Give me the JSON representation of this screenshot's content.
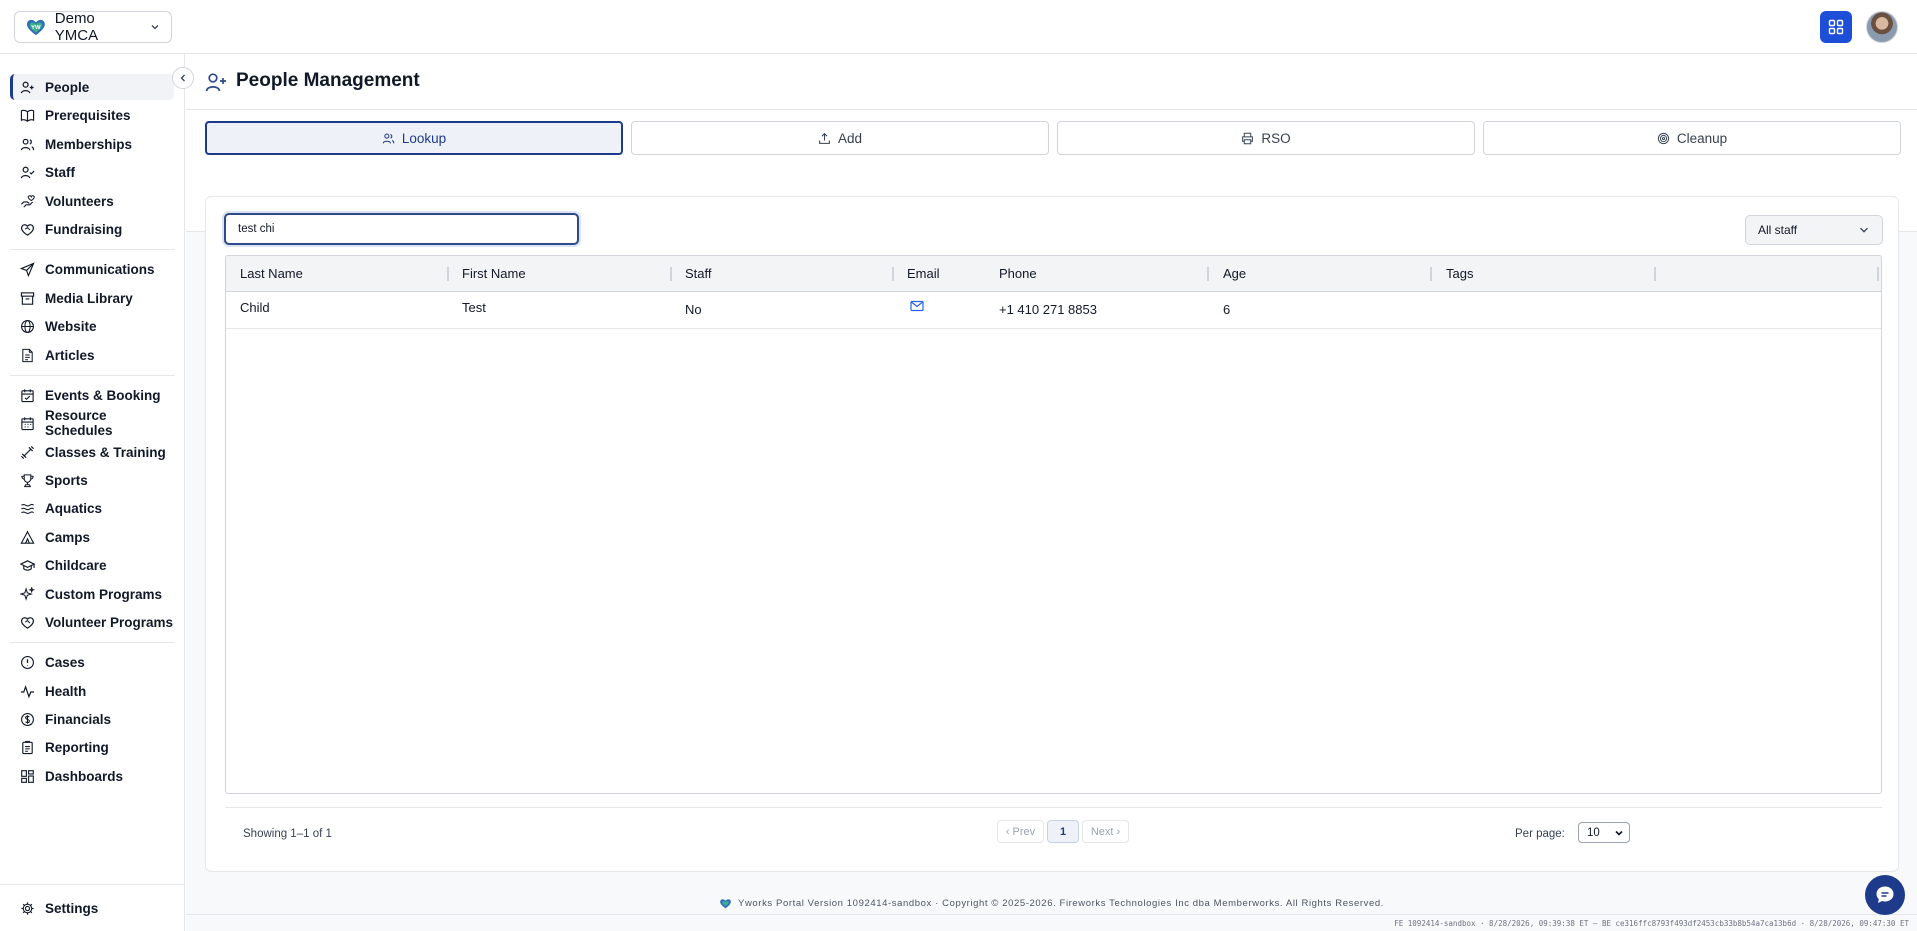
{
  "org": {
    "name": "Demo YMCA",
    "logo_text": "YW"
  },
  "sidebar": {
    "items": [
      {
        "label": "People",
        "icon": "user-plus-icon",
        "active": true
      },
      {
        "label": "Prerequisites",
        "icon": "book-icon"
      },
      {
        "label": "Memberships",
        "icon": "users-icon"
      },
      {
        "label": "Staff",
        "icon": "user-check-icon"
      },
      {
        "label": "Volunteers",
        "icon": "hand-heart-icon"
      },
      {
        "label": "Fundraising",
        "icon": "heart-handshake-icon"
      },
      {
        "label": "Communications",
        "icon": "send-icon"
      },
      {
        "label": "Media Library",
        "icon": "archive-icon"
      },
      {
        "label": "Website",
        "icon": "globe-icon"
      },
      {
        "label": "Articles",
        "icon": "file-text-icon"
      },
      {
        "label": "Events & Booking",
        "icon": "calendar-check-icon"
      },
      {
        "label": "Resource Schedules",
        "icon": "calendar-icon"
      },
      {
        "label": "Classes & Training",
        "icon": "dumbbell-icon"
      },
      {
        "label": "Sports",
        "icon": "trophy-icon"
      },
      {
        "label": "Aquatics",
        "icon": "waves-icon"
      },
      {
        "label": "Camps",
        "icon": "tent-icon"
      },
      {
        "label": "Childcare",
        "icon": "graduation-cap-icon"
      },
      {
        "label": "Custom Programs",
        "icon": "sparkles-icon"
      },
      {
        "label": "Volunteer Programs",
        "icon": "heart-handshake-icon"
      },
      {
        "label": "Cases",
        "icon": "alert-circle-icon"
      },
      {
        "label": "Health",
        "icon": "activity-icon"
      },
      {
        "label": "Financials",
        "icon": "dollar-circle-icon"
      },
      {
        "label": "Reporting",
        "icon": "clipboard-icon"
      },
      {
        "label": "Dashboards",
        "icon": "layout-dashboard-icon"
      }
    ],
    "settings_label": "Settings"
  },
  "page": {
    "title": "People Management"
  },
  "tabs": [
    {
      "label": "Lookup",
      "icon": "users-icon",
      "active": true
    },
    {
      "label": "Add",
      "icon": "upload-icon"
    },
    {
      "label": "RSO",
      "icon": "printer-icon"
    },
    {
      "label": "Cleanup",
      "icon": "target-icon"
    }
  ],
  "search": {
    "value": "test chi",
    "placeholder": ""
  },
  "staff_filter": {
    "selected": "All staff"
  },
  "table": {
    "columns": [
      "Last Name",
      "First Name",
      "Staff",
      "Email",
      "Phone",
      "Age",
      "Tags"
    ],
    "rows": [
      {
        "last_name": "Child",
        "first_name": "Test",
        "staff": "No",
        "email_icon": "mail-icon",
        "phone": "+1 410 271 8853",
        "age": "6",
        "tags": ""
      }
    ]
  },
  "pagination": {
    "showing": "Showing 1–1 of 1",
    "prev_label": "‹ Prev",
    "current_page": "1",
    "next_label": "Next ›",
    "per_page_label": "Per page:",
    "per_page_value": "10"
  },
  "footer": {
    "text": "Yworks Portal Version 1092414-sandbox · Copyright © 2025-2026. Fireworks Technologies Inc dba Memberworks. All Rights Reserved.",
    "build": "FE 1092414-sandbox · 8/28/2026, 09:39:38 ET — BE ce316ffc8793f493df2453cb33b8b54a7ca13b6d · 8/28/2026, 09:47:30 ET"
  },
  "colors": {
    "accent": "#1e3a8a",
    "apps_button": "#1d4ed8",
    "brand_heart": "#2f6fb8"
  }
}
